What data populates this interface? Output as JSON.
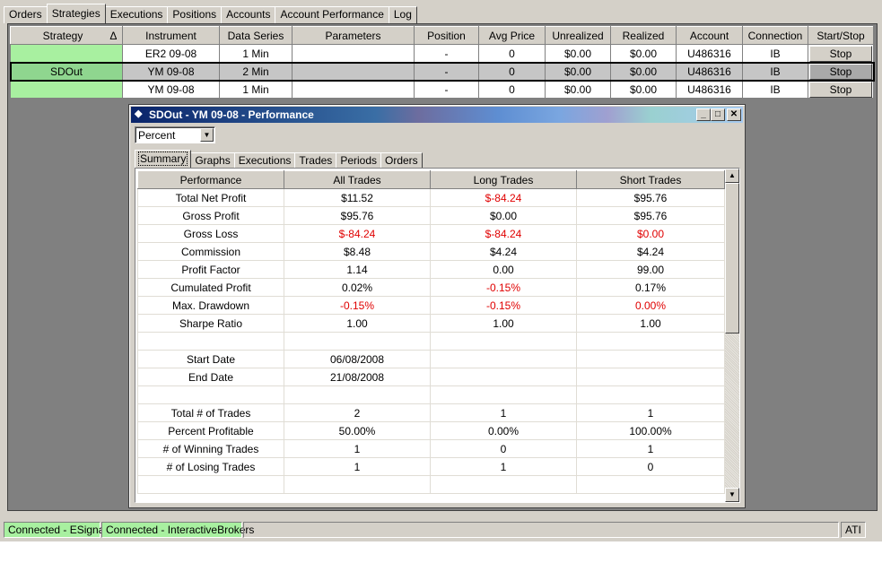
{
  "main_tabs": [
    "Orders",
    "Strategies",
    "Executions",
    "Positions",
    "Accounts",
    "Account Performance",
    "Log"
  ],
  "main_tabs_active": 1,
  "strategies": {
    "columns": [
      "Strategy",
      "Instrument",
      "Data Series",
      "Parameters",
      "Position",
      "Avg Price",
      "Unrealized",
      "Realized",
      "Account",
      "Connection",
      "Start/Stop"
    ],
    "sort_indicator": "Δ",
    "rows": [
      {
        "strategy": "",
        "instrument": "ER2 09-08",
        "data_series": "1 Min",
        "parameters": "",
        "position": "-",
        "avg_price": "0",
        "unrealized": "$0.00",
        "realized": "$0.00",
        "account": "U486316",
        "connection": "IB",
        "action": "Stop"
      },
      {
        "strategy": "SDOut",
        "instrument": "YM 09-08",
        "data_series": "2 Min",
        "parameters": "",
        "position": "-",
        "avg_price": "0",
        "unrealized": "$0.00",
        "realized": "$0.00",
        "account": "U486316",
        "connection": "IB",
        "action": "Stop"
      },
      {
        "strategy": "",
        "instrument": "YM 09-08",
        "data_series": "1 Min",
        "parameters": "",
        "position": "-",
        "avg_price": "0",
        "unrealized": "$0.00",
        "realized": "$0.00",
        "account": "U486316",
        "connection": "IB",
        "action": "Stop"
      }
    ],
    "selected_row": 1
  },
  "performance_window": {
    "title": "SDOut - YM 09-08 - Performance",
    "mode_value": "Percent",
    "tabs": [
      "Summary",
      "Graphs",
      "Executions",
      "Trades",
      "Periods",
      "Orders"
    ],
    "active_tab": 0,
    "columns": [
      "Performance",
      "All Trades",
      "Long Trades",
      "Short Trades"
    ],
    "rows": [
      {
        "label": "Total Net Profit",
        "all": "$11.52",
        "long": "$-84.24",
        "short": "$95.76",
        "neg": [
          false,
          true,
          false
        ]
      },
      {
        "label": "Gross Profit",
        "all": "$95.76",
        "long": "$0.00",
        "short": "$95.76",
        "neg": [
          false,
          false,
          false
        ]
      },
      {
        "label": "Gross Loss",
        "all": "$-84.24",
        "long": "$-84.24",
        "short": "$0.00",
        "neg": [
          true,
          true,
          true
        ]
      },
      {
        "label": "Commission",
        "all": "$8.48",
        "long": "$4.24",
        "short": "$4.24",
        "neg": [
          false,
          false,
          false
        ]
      },
      {
        "label": "Profit Factor",
        "all": "1.14",
        "long": "0.00",
        "short": "99.00",
        "neg": [
          false,
          false,
          false
        ]
      },
      {
        "label": "Cumulated Profit",
        "all": "0.02%",
        "long": "-0.15%",
        "short": "0.17%",
        "neg": [
          false,
          true,
          false
        ]
      },
      {
        "label": "Max. Drawdown",
        "all": "-0.15%",
        "long": "-0.15%",
        "short": "0.00%",
        "neg": [
          true,
          true,
          true
        ]
      },
      {
        "label": "Sharpe Ratio",
        "all": "1.00",
        "long": "1.00",
        "short": "1.00",
        "neg": [
          false,
          false,
          false
        ]
      },
      {
        "label": "",
        "all": "",
        "long": "",
        "short": "",
        "neg": [
          false,
          false,
          false
        ]
      },
      {
        "label": "Start Date",
        "all": "06/08/2008",
        "long": "",
        "short": "",
        "neg": [
          false,
          false,
          false
        ]
      },
      {
        "label": "End Date",
        "all": "21/08/2008",
        "long": "",
        "short": "",
        "neg": [
          false,
          false,
          false
        ]
      },
      {
        "label": "",
        "all": "",
        "long": "",
        "short": "",
        "neg": [
          false,
          false,
          false
        ]
      },
      {
        "label": "Total # of Trades",
        "all": "2",
        "long": "1",
        "short": "1",
        "neg": [
          false,
          false,
          false
        ]
      },
      {
        "label": "Percent Profitable",
        "all": "50.00%",
        "long": "0.00%",
        "short": "100.00%",
        "neg": [
          false,
          false,
          false
        ]
      },
      {
        "label": "# of Winning Trades",
        "all": "1",
        "long": "0",
        "short": "1",
        "neg": [
          false,
          false,
          false
        ]
      },
      {
        "label": "# of Losing Trades",
        "all": "1",
        "long": "1",
        "short": "0",
        "neg": [
          false,
          false,
          false
        ]
      },
      {
        "label": "",
        "all": "",
        "long": "",
        "short": "",
        "neg": [
          false,
          false,
          false
        ]
      }
    ]
  },
  "status": {
    "esignal": "Connected - ESignal",
    "ib": "Connected - InteractiveBrokers",
    "ati": "ATI"
  },
  "colors": {
    "connected_green": "#a8f0a0",
    "negative_red": "#e00000",
    "title_bar": "#0a246a"
  }
}
